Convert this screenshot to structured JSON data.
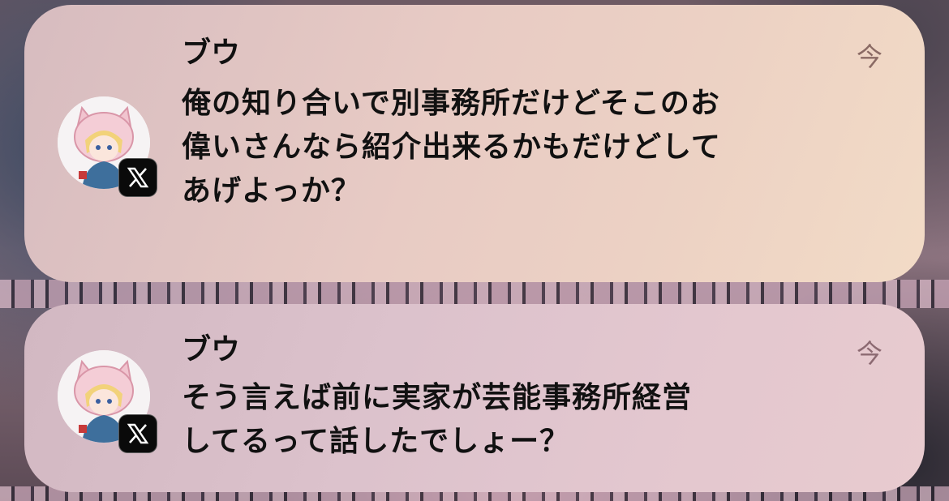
{
  "notifications": [
    {
      "app": "X",
      "app_icon": "x-logo-icon",
      "sender": "ブウ",
      "time": "今",
      "message_lines": [
        "俺の知り合いで別事務所だけどそこのお",
        "偉いさんなら紹介出来るかもだけどして",
        "あげよっか？"
      ]
    },
    {
      "app": "X",
      "app_icon": "x-logo-icon",
      "sender": "ブウ",
      "time": "今",
      "message_lines": [
        "そう言えば前に実家が芸能事務所経営",
        "してるって話したでしょー？"
      ]
    }
  ],
  "colors": {
    "text": "#111111",
    "timestamp": "#8a6a64",
    "badge": "#0a0a0a"
  }
}
